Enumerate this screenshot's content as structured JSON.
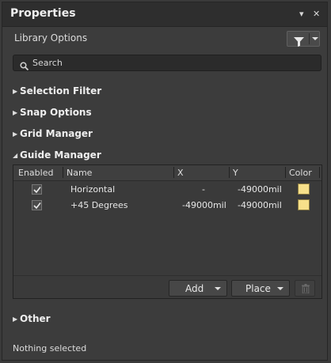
{
  "panel": {
    "title": "Properties",
    "pin_symbol": "▾",
    "close_symbol": "✕",
    "subtitle": "Library Options"
  },
  "search": {
    "placeholder": "Search",
    "value": ""
  },
  "sections": {
    "selection_filter": "Selection Filter",
    "snap_options": "Snap Options",
    "grid_manager": "Grid Manager",
    "guide_manager": "Guide Manager",
    "other": "Other"
  },
  "guide_table": {
    "columns": [
      "Enabled",
      "Name",
      "X",
      "Y",
      "Color"
    ],
    "rows": [
      {
        "enabled": true,
        "name": "Horizontal",
        "x": "-",
        "y": "-49000mil",
        "color": "#f7e08a"
      },
      {
        "enabled": true,
        "name": "+45 Degrees",
        "x": "-49000mil",
        "y": "-49000mil",
        "color": "#f7e08a"
      }
    ],
    "add_label": "Add",
    "place_label": "Place"
  },
  "status": "Nothing selected",
  "icons": {
    "filter": "funnel-icon",
    "search": "magnifier-icon",
    "delete": "trash-icon"
  }
}
